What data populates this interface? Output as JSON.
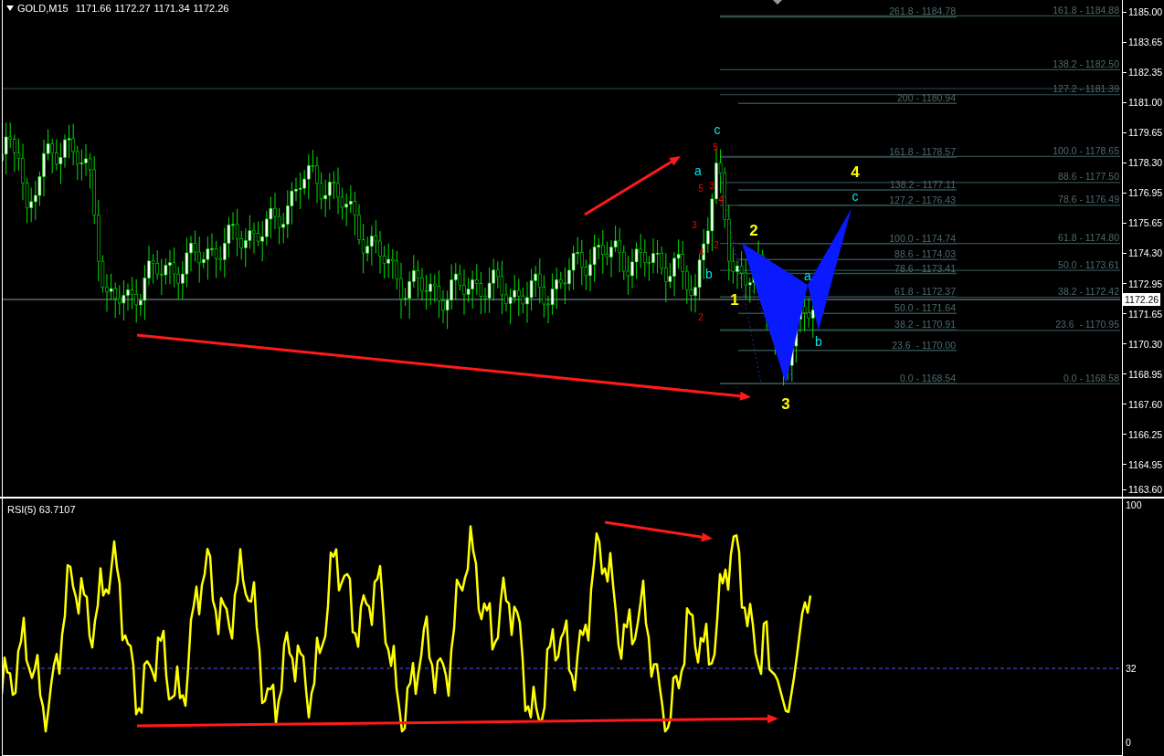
{
  "header": {
    "symbol": "GOLD,M15",
    "ohlc": [
      "1171.66",
      "1172.27",
      "1171.34",
      "1172.26"
    ]
  },
  "price_axis": {
    "labels": [
      "1185.00",
      "1183.65",
      "1182.35",
      "1181.00",
      "1179.65",
      "1178.30",
      "1176.95",
      "1175.65",
      "1174.30",
      "1172.95",
      "1171.65",
      "1170.30",
      "1168.95",
      "1167.60",
      "1166.25",
      "1164.95",
      "1163.60"
    ],
    "current_price": "1172.26"
  },
  "fib_retracement": [
    {
      "label": "261.8 - 1184.78"
    },
    {
      "label": "200 - 1180.94"
    },
    {
      "label": "161.8 - 1178.57"
    },
    {
      "label": "138.2 - 1177.11"
    },
    {
      "label": "127.2 - 1176.43"
    },
    {
      "label": "100.0 - 1174.74"
    },
    {
      "label": "88.6 - 1174.03"
    },
    {
      "label": "78.6 - 1173.41"
    },
    {
      "label": "61.8 - 1172.37"
    },
    {
      "label": "50.0 - 1171.64"
    },
    {
      "label": "38.2 - 1170.91"
    },
    {
      "label": "23.6  - 1170.00"
    },
    {
      "label": "0.0 - 1168.54"
    }
  ],
  "fib_extension": [
    {
      "label": "161.8 - 1184.88"
    },
    {
      "label": "138.2 - 1182.50"
    },
    {
      "label": "127.2 - 1181.39"
    },
    {
      "label": "100.0 - 1178.65"
    },
    {
      "label": "88.6 - 1177.50"
    },
    {
      "label": "78.6 - 1176.49"
    },
    {
      "label": "61.8 - 1174.80"
    },
    {
      "label": "50.0 - 1173.61"
    },
    {
      "label": "38.2 - 1172.42"
    },
    {
      "label": "23.6  - 1170.95"
    },
    {
      "label": "0.0 - 1168.58"
    }
  ],
  "wave_labels": [
    {
      "text": "c",
      "kind": "minor"
    },
    {
      "text": "5",
      "kind": "sub"
    },
    {
      "text": "a",
      "kind": "minor"
    },
    {
      "text": "3",
      "kind": "sub"
    },
    {
      "text": "5",
      "kind": "sub"
    },
    {
      "text": "4",
      "kind": "sub"
    },
    {
      "text": "3",
      "kind": "sub"
    },
    {
      "text": "2",
      "kind": "sub"
    },
    {
      "text": "4",
      "kind": "sub"
    },
    {
      "text": "2",
      "kind": "sub"
    },
    {
      "text": "4",
      "kind": "major"
    },
    {
      "text": "c",
      "kind": "minor"
    },
    {
      "text": "2",
      "kind": "major"
    },
    {
      "text": "b",
      "kind": "minor"
    },
    {
      "text": "1",
      "kind": "major"
    },
    {
      "text": "a",
      "kind": "minor"
    },
    {
      "text": "b",
      "kind": "minor"
    },
    {
      "text": "3",
      "kind": "major"
    }
  ],
  "rsi": {
    "title": "RSI(5) 63.7107",
    "axis_labels": [
      "100",
      "32",
      "0"
    ]
  }
}
